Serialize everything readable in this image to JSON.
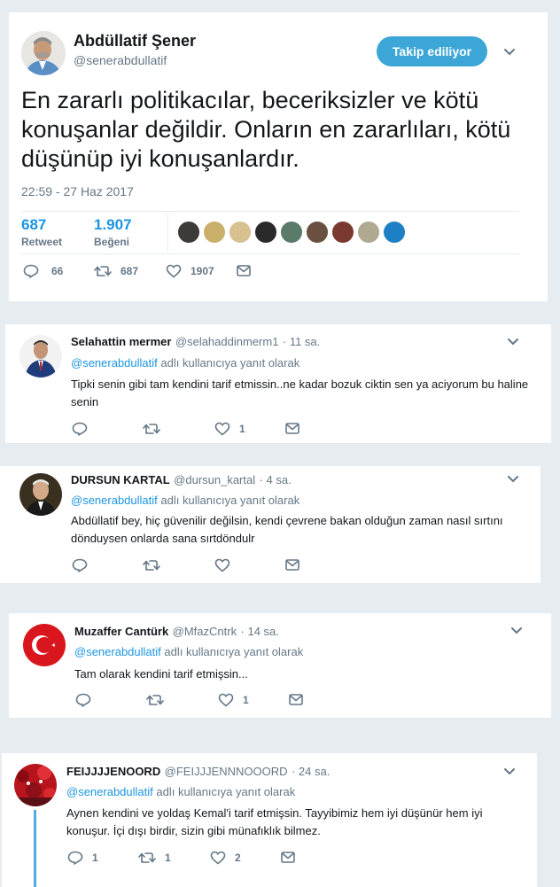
{
  "main": {
    "author_name": "Abdüllatif Şener",
    "author_handle": "@senerabdullatif",
    "follow_label": "Takip ediliyor",
    "text": "En zararlı politikacılar, beceriksizler ve kötü konuşanlar değildir. Onların en zararlıları, kötü düşünüp iyi konuşanlardır.",
    "timestamp": "22:59 - 27 Haz 2017",
    "retweet_count": "687",
    "retweet_label": "Retweet",
    "like_count": "1.907",
    "like_label": "Beğeni",
    "actions": {
      "reply": "66",
      "retweet": "687",
      "like": "1907"
    },
    "liker_colors": [
      "#3d3b38",
      "#c8b06a",
      "#d8c090",
      "#2a2a2a",
      "#5a7a6a",
      "#6a5040",
      "#7a3a30",
      "#b0a890",
      "#1d7fc4"
    ]
  },
  "replies": [
    {
      "name": "Selahattin mermer",
      "handle": "@selahaddinmerm1",
      "time": "· 11 sa.",
      "mention": "@senerabdullatif",
      "reply_suffix": "adlı kullanıcıya yanıt olarak",
      "text": "Tipki senin gibi tam kendini tarif etmissin..ne kadar bozuk ciktin sen ya aciyorum bu haline senin",
      "counts": {
        "reply": "",
        "retweet": "",
        "like": "1"
      }
    },
    {
      "name": "DURSUN KARTAL",
      "handle": "@dursun_kartal",
      "time": "· 4 sa.",
      "mention": "@senerabdullatif",
      "reply_suffix": "adlı kullanıcıya yanıt olarak",
      "text": "Abdüllatif bey, hiç güvenilir değilsin, kendi çevrene bakan olduğun zaman nasıl sırtını dönduysen onlarda sana sırtdöndulr",
      "counts": {
        "reply": "",
        "retweet": "",
        "like": ""
      }
    },
    {
      "name": "Muzaffer Cantürk",
      "handle": "@MfazCntrk",
      "time": "· 14 sa.",
      "mention": "@senerabdullatif",
      "reply_suffix": "adlı kullanıcıya yanıt olarak",
      "text": "Tam olarak kendini tarif etmişsin...",
      "counts": {
        "reply": "",
        "retweet": "",
        "like": "1"
      }
    },
    {
      "name": "FEIJJJJENOORD",
      "handle": "@FEIJJJENNNOOORD",
      "time": "· 24 sa.",
      "mention": "@senerabdullatif",
      "reply_suffix": "adlı kullanıcıya yanıt olarak",
      "text": "Aynen kendini ve yoldaş Kemal'i  tarif etmişsin.  Tayyibimiz hem iyi düşünür hem iyi konuşur. İçi dışı birdir, sizin gibi münafıklık bilmez.",
      "counts": {
        "reply": "1",
        "retweet": "1",
        "like": "2"
      }
    }
  ],
  "colors": {
    "accent": "#1da1f2",
    "link": "#1b95e0",
    "muted": "#657786",
    "follow_button": "#3ca7d6",
    "background": "#e6ecf0"
  }
}
